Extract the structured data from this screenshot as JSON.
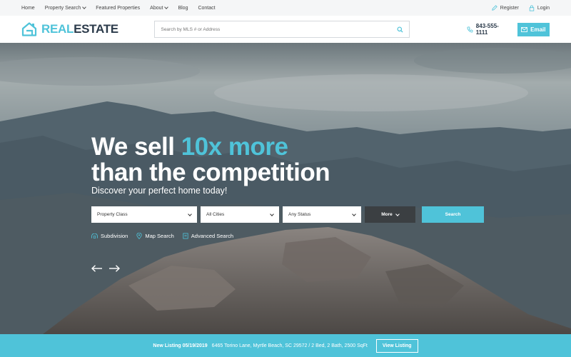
{
  "topnav": {
    "items": [
      {
        "label": "Home"
      },
      {
        "label": "Property Search"
      },
      {
        "label": "Featured Properties"
      },
      {
        "label": "About"
      },
      {
        "label": "Blog"
      },
      {
        "label": "Contact"
      }
    ],
    "register": "Register",
    "login": "Login"
  },
  "header": {
    "logo_part1": "REAL",
    "logo_part2": "ESTATE",
    "search_placeholder": "Search by MLS # or Address",
    "phone": "843-555-1111",
    "email_label": "Email"
  },
  "hero": {
    "headline_pre": "We sell ",
    "headline_accent": "10x more",
    "headline_line2": "than the competition",
    "subtitle": "Discover your perfect home today!",
    "filters": {
      "property_class": "Property Class",
      "cities": "All Cities",
      "status": "Any Status",
      "more": "More",
      "search": "Search"
    },
    "links": {
      "subdivision": "Subdivision",
      "map_search": "Map Search",
      "advanced_search": "Advanced Search"
    }
  },
  "listing_bar": {
    "new_listing": "New Listing 05/19/2019",
    "details": "6465 Torino Lane, Myrtle Beach, SC 29572  /  2 Bed, 2 Bath, 2500 SqFt",
    "view_label": "View Listing"
  },
  "colors": {
    "accent": "#4fc3d9",
    "dark": "#2b3a4a",
    "more_button": "#3b3f42"
  }
}
